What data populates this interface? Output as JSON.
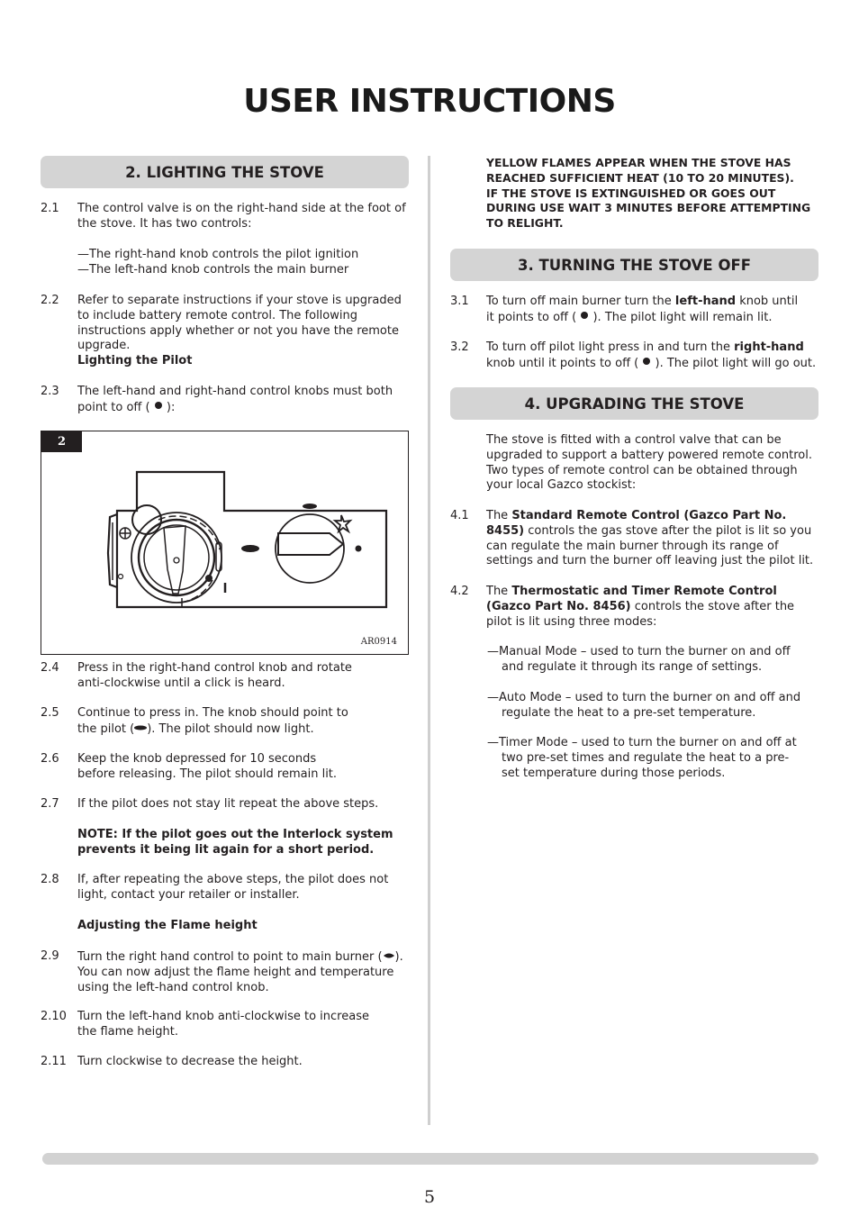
{
  "page": {
    "title": "USER INSTRUCTIONS",
    "page_number": "5"
  },
  "sections": {
    "lighting": {
      "heading": "2. LIGHTING THE STOVE",
      "p2_1_num": "2.1",
      "p2_1": "The control valve is on the right-hand side at the foot of the stove. It has two controls:",
      "dash1": "—The right-hand knob controls the pilot ignition",
      "dash2": "—The left-hand knob controls the main burner",
      "p2_2_num": "2.2",
      "p2_2": "Refer to separate instructions if your stove is upgraded to include battery remote control. The following instructions apply whether or not you have the remote upgrade.",
      "sub_pilot": "Lighting the Pilot",
      "p2_3_num": "2.3",
      "p2_3_a": "The left-hand and right-hand control knobs must both point to off (",
      "p2_3_b": "):",
      "figure_number": "2",
      "figure_code": "AR0914",
      "p2_4_num": "2.4",
      "p2_4": "Press in the right-hand control knob and rotate anti-clockwise until a click is heard.",
      "p2_5_num": "2.5",
      "p2_5_a": "Continue to press in. The knob should point to the pilot (",
      "p2_5_b": "). The pilot should now light.",
      "p2_6_num": "2.6",
      "p2_6": "Keep the knob depressed for 10 seconds before releasing. The pilot should remain lit.",
      "p2_7_num": "2.7",
      "p2_7": "If the pilot does not stay lit repeat the above steps.",
      "note": "NOTE: If the pilot goes out the Interlock system prevents it being lit again for a short period.",
      "p2_8_num": "2.8",
      "p2_8": "If, after repeating the above steps, the pilot does not light, contact your retailer or installer.",
      "sub_flame": "Adjusting the Flame height",
      "p2_9_num": "2.9",
      "p2_9_a": "Turn the right hand control to point to main burner (",
      "p2_9_b": "). You can now adjust the flame height and temperature using the left-hand control knob.",
      "p2_10_num": "2.10",
      "p2_10": "Turn the left-hand knob anti-clockwise to increase the flame height.",
      "p2_11_num": "2.11",
      "p2_11": "Turn clockwise to decrease the height."
    },
    "warning": {
      "line1": "YELLOW FLAMES APPEAR WHEN THE STOVE HAS",
      "line2": "REACHED SUFFICIENT HEAT (10 TO 20 MINUTES).",
      "line3": "IF THE STOVE IS EXTINGUISHED OR GOES OUT",
      "line4": "DURING USE WAIT 3 MINUTES BEFORE ATTEMPTING",
      "line5": "TO RELIGHT."
    },
    "turning_off": {
      "heading": "3. TURNING THE STOVE OFF",
      "p3_1_num": "3.1",
      "p3_1_a": "To turn off main burner turn the ",
      "p3_1_bold": "left-hand",
      "p3_1_b": " knob until it points to off (",
      "p3_1_c": "). The pilot light will remain lit.",
      "p3_2_num": "3.2",
      "p3_2_a": "To turn off pilot light press in and turn the ",
      "p3_2_bold": "right-hand",
      "p3_2_b": " knob until it points to off (",
      "p3_2_c": "). The pilot light will go out."
    },
    "upgrading": {
      "heading": "4. UPGRADING THE STOVE",
      "intro": "The stove is fitted with a control valve that can be upgraded to support a battery powered remote control. Two types of remote control can be obtained through your local Gazco stockist:",
      "p4_1_num": "4.1",
      "p4_1_a": "The ",
      "p4_1_bold": "Standard Remote Control (Gazco Part No. 8455)",
      "p4_1_b": " controls the gas stove after the pilot is lit so you can regulate the main burner through its range of settings and turn the burner off leaving just the pilot lit.",
      "p4_2_num": "4.2",
      "p4_2_a": "The ",
      "p4_2_bold": "Thermostatic and Timer Remote Control (Gazco Part No. 8456)",
      "p4_2_b": " controls the stove after the pilot is lit using three modes:",
      "mode_manual": "—Manual Mode – used to turn the burner on and off and regulate it through its range of settings.",
      "mode_auto": "—Auto Mode – used to turn the burner on and off and regulate the heat to a pre-set temperature.",
      "mode_timer": "—Timer Mode – used to turn the burner on and off at two pre-set times and regulate the heat to a pre-set temperature during those periods."
    }
  },
  "icons": {
    "off": "off-dot-icon",
    "pilot": "pilot-flame-icon",
    "main_burner": "main-burner-flame-icon"
  }
}
